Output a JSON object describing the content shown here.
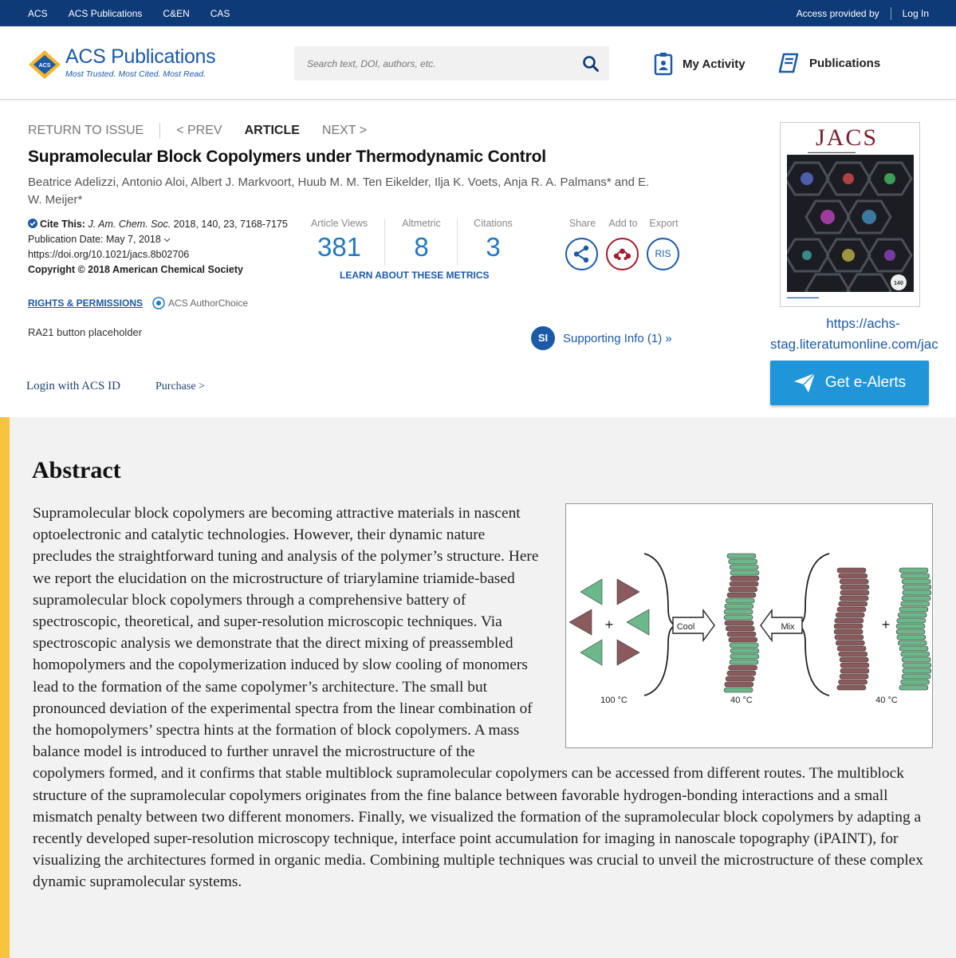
{
  "topbar": {
    "links": [
      "ACS",
      "ACS Publications",
      "C&EN",
      "CAS"
    ],
    "access_text": "Access provided by",
    "login": "Log In"
  },
  "header": {
    "logo_name": "ACS Publications",
    "logo_tagline": "Most Trusted. Most Cited. Most Read.",
    "search_placeholder": "Search text, DOI, authors, etc.",
    "my_activity": "My Activity",
    "publications": "Publications"
  },
  "article_nav": {
    "return": "RETURN TO ISSUE",
    "prev": "< PREV",
    "current": "ARTICLE",
    "next": "NEXT >"
  },
  "article": {
    "title": "Supramolecular Block Copolymers under Thermodynamic Control",
    "authors": "Beatrice Adelizzi, Antonio Aloi, Albert J. Markvoort, Huub M. M. Ten Eikelder, Ilja K. Voets, Anja R. A. Palmans* and E. W. Meijer*",
    "cite_label": "Cite This:",
    "cite_journal": "J. Am. Chem. Soc.",
    "cite_rest": "2018, 140, 23, 7168-7175",
    "pub_date": "Publication Date: May 7, 2018",
    "doi": "https://doi.org/10.1021/jacs.8b02706",
    "copyright": "Copyright © 2018 American Chemical Society",
    "rights": "RIGHTS & PERMISSIONS",
    "authorchoice": "ACS AuthorChoice",
    "ra21": "RA21 button placeholder",
    "login_acs": "Login with ACS ID",
    "purchase": "Purchase >"
  },
  "metrics": {
    "views_label": "Article Views",
    "views": "381",
    "altmetric_label": "Altmetric",
    "altmetric": "8",
    "citations_label": "Citations",
    "citations": "3",
    "learn": "LEARN ABOUT THESE METRICS"
  },
  "actions": {
    "share": "Share",
    "add_to": "Add to",
    "export": "Export",
    "ris": "RIS",
    "si_badge": "SI",
    "supporting_info": "Supporting Info (1) »"
  },
  "cover": {
    "journal": "JACS",
    "url_line1": "https://achs-",
    "url_line2": "stag.literatumonline.com/jac"
  },
  "ealerts": "Get e-Alerts",
  "abstract": {
    "heading": "Abstract",
    "text": "Supramolecular block copolymers are becoming attractive materials in nascent optoelectronic and catalytic technologies. However, their dynamic nature precludes the straightforward tuning and analysis of the polymer’s structure. Here we report the elucidation on the microstructure of triarylamine triamide-based supramolecular block copolymers through a comprehensive battery of spectroscopic, theoretical, and super-resolution microscopic techniques. Via spectroscopic analysis we demonstrate that the direct mixing of preassembled homopolymers and the copolymerization induced by slow cooling of monomers lead to the formation of the same copolymer’s architecture. The small but pronounced deviation of the experimental spectra from the linear combination of the homopolymers’ spectra hints at the formation of block copolymers. A mass balance model is introduced to further unravel the microstructure of the copolymers formed, and it confirms that stable multiblock supramolecular copolymers can be accessed from different routes. The multiblock structure of the supramolecular copolymers originates from the fine balance between favorable hydrogen-bonding interactions and a small mismatch penalty between two different monomers. Finally, we visualized the formation of the supramolecular block copolymers by adapting a recently developed super-resolution microscopy technique, interface point accumulation for imaging in nanoscale topography (iPAINT), for visualizing the architectures formed in organic media. Combining multiple techniques was crucial to unveil the microstructure of these complex dynamic supramolecular systems.",
    "toc": {
      "cool": "Cool",
      "mix": "Mix",
      "plus": "+",
      "temp_left": "100 °C",
      "temp_mid": "40 °C",
      "temp_right": "40 °C",
      "green": "#6cb88a",
      "brown": "#8a5a5c"
    }
  }
}
